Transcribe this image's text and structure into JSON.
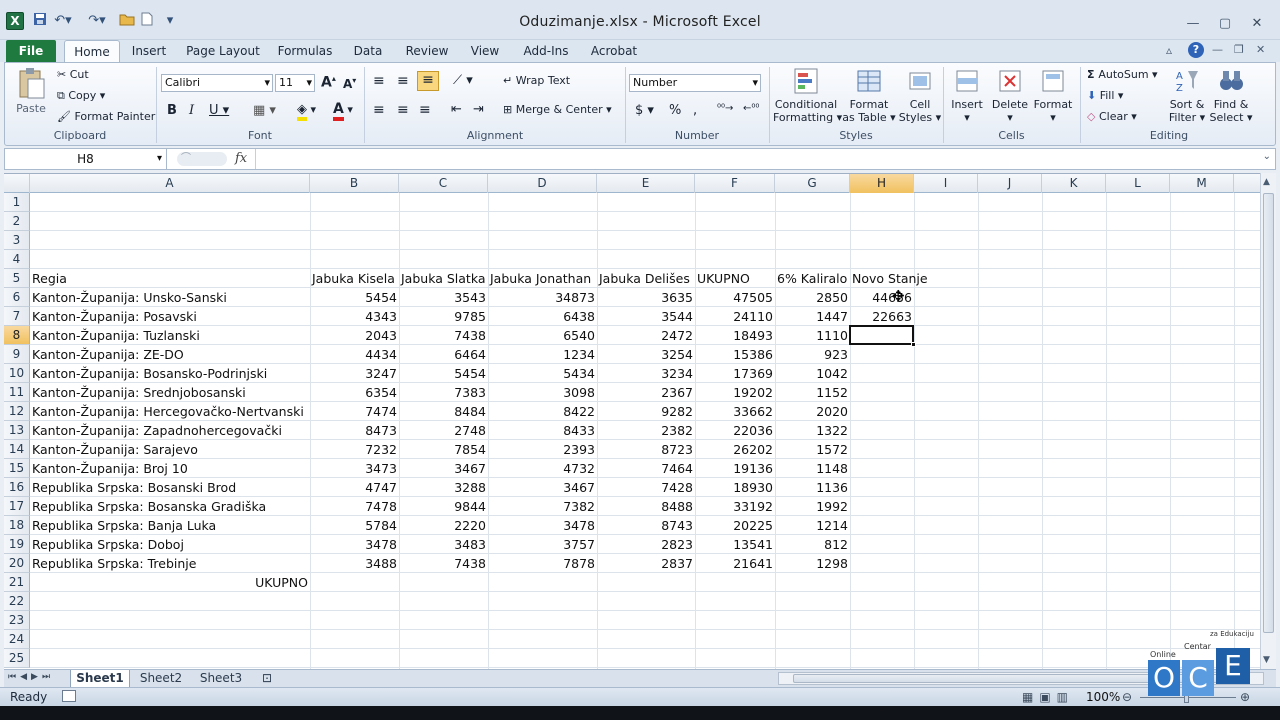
{
  "window": {
    "title": "Oduzimanje.xlsx  -  Microsoft Excel"
  },
  "tabs": [
    "File",
    "Home",
    "Insert",
    "Page Layout",
    "Formulas",
    "Data",
    "Review",
    "View",
    "Add-Ins",
    "Acrobat"
  ],
  "ribbon": {
    "clipboard": {
      "paste": "Paste",
      "cut": "Cut",
      "copy": "Copy",
      "format_painter": "Format Painter",
      "label": "Clipboard"
    },
    "font": {
      "name": "Calibri",
      "size": "11",
      "label": "Font"
    },
    "alignment": {
      "wrap": "Wrap Text",
      "merge": "Merge & Center",
      "label": "Alignment"
    },
    "number": {
      "format": "Number",
      "label": "Number"
    },
    "styles": {
      "cond1": "Conditional",
      "cond2": "Formatting",
      "fmt1": "Format",
      "fmt2": "as Table",
      "cell1": "Cell",
      "cell2": "Styles",
      "label": "Styles"
    },
    "cells": {
      "insert": "Insert",
      "delete": "Delete",
      "format": "Format",
      "label": "Cells"
    },
    "editing": {
      "autosum": "AutoSum",
      "fill": "Fill",
      "clear": "Clear",
      "sort1": "Sort &",
      "sort2": "Filter",
      "find1": "Find &",
      "find2": "Select",
      "label": "Editing"
    }
  },
  "formula_bar": {
    "name_box": "H8",
    "fx": "fx",
    "value": ""
  },
  "columns": [
    "A",
    "B",
    "C",
    "D",
    "E",
    "F",
    "G",
    "H",
    "I",
    "J",
    "K",
    "L",
    "M"
  ],
  "rows": [
    {
      "n": "1",
      "cells": [
        "",
        "",
        "",
        "",
        "",
        "",
        "",
        ""
      ]
    },
    {
      "n": "2",
      "cells": [
        "",
        "",
        "",
        "",
        "",
        "",
        "",
        ""
      ]
    },
    {
      "n": "3",
      "cells": [
        "",
        "",
        "",
        "",
        "",
        "",
        "",
        ""
      ]
    },
    {
      "n": "4",
      "cells": [
        "",
        "",
        "",
        "",
        "",
        "",
        "",
        ""
      ]
    },
    {
      "n": "5",
      "cells": [
        "Regia",
        "Jabuka Kisela",
        "Jabuka Slatka",
        "Jabuka Jonathan",
        "Jabuka Delišes",
        "UKUPNO",
        "6% Kaliralo",
        "Novo Stanje"
      ]
    },
    {
      "n": "6",
      "cells": [
        "Kanton-Županija: Unsko-Sanski",
        "5454",
        "3543",
        "34873",
        "3635",
        "47505",
        "2850",
        "44656"
      ]
    },
    {
      "n": "7",
      "cells": [
        "Kanton-Županija: Posavski",
        "4343",
        "9785",
        "6438",
        "3544",
        "24110",
        "1447",
        "22663"
      ]
    },
    {
      "n": "8",
      "cells": [
        "Kanton-Županija: Tuzlanski",
        "2043",
        "7438",
        "6540",
        "2472",
        "18493",
        "1110",
        ""
      ]
    },
    {
      "n": "9",
      "cells": [
        "Kanton-Županija: ZE-DO",
        "4434",
        "6464",
        "1234",
        "3254",
        "15386",
        "923",
        ""
      ]
    },
    {
      "n": "10",
      "cells": [
        "Kanton-Županija: Bosansko-Podrinjski",
        "3247",
        "5454",
        "5434",
        "3234",
        "17369",
        "1042",
        ""
      ]
    },
    {
      "n": "11",
      "cells": [
        "Kanton-Županija: Srednjobosanski",
        "6354",
        "7383",
        "3098",
        "2367",
        "19202",
        "1152",
        ""
      ]
    },
    {
      "n": "12",
      "cells": [
        "Kanton-Županija: Hercegovačko-Nertvanski",
        "7474",
        "8484",
        "8422",
        "9282",
        "33662",
        "2020",
        ""
      ]
    },
    {
      "n": "13",
      "cells": [
        "Kanton-Županija: Zapadnohercegovački",
        "8473",
        "2748",
        "8433",
        "2382",
        "22036",
        "1322",
        ""
      ]
    },
    {
      "n": "14",
      "cells": [
        "Kanton-Županija: Sarajevo",
        "7232",
        "7854",
        "2393",
        "8723",
        "26202",
        "1572",
        ""
      ]
    },
    {
      "n": "15",
      "cells": [
        "Kanton-Županija: Broj 10",
        "3473",
        "3467",
        "4732",
        "7464",
        "19136",
        "1148",
        ""
      ]
    },
    {
      "n": "16",
      "cells": [
        "Republika Srpska: Bosanski Brod",
        "4747",
        "3288",
        "3467",
        "7428",
        "18930",
        "1136",
        ""
      ]
    },
    {
      "n": "17",
      "cells": [
        "Republika Srpska: Bosanska Gradiška",
        "7478",
        "9844",
        "7382",
        "8488",
        "33192",
        "1992",
        ""
      ]
    },
    {
      "n": "18",
      "cells": [
        "Republika Srpska: Banja Luka",
        "5784",
        "2220",
        "3478",
        "8743",
        "20225",
        "1214",
        ""
      ]
    },
    {
      "n": "19",
      "cells": [
        "Republika Srpska: Doboj",
        "3478",
        "3483",
        "3757",
        "2823",
        "13541",
        "812",
        ""
      ]
    },
    {
      "n": "20",
      "cells": [
        "Republika Srpska: Trebinje",
        "3488",
        "7438",
        "7878",
        "2837",
        "21641",
        "1298",
        ""
      ]
    },
    {
      "n": "21",
      "cells": [
        "UKUPNO",
        "",
        "",
        "",
        "",
        "",
        "",
        ""
      ]
    },
    {
      "n": "22",
      "cells": [
        "",
        "",
        "",
        "",
        "",
        "",
        "",
        ""
      ]
    },
    {
      "n": "23",
      "cells": [
        "",
        "",
        "",
        "",
        "",
        "",
        "",
        ""
      ]
    },
    {
      "n": "24",
      "cells": [
        "",
        "",
        "",
        "",
        "",
        "",
        "",
        ""
      ]
    },
    {
      "n": "25",
      "cells": [
        "",
        "",
        "",
        "",
        "",
        "",
        "",
        ""
      ]
    }
  ],
  "selected_cell": "H8",
  "sheets": [
    "Sheet1",
    "Sheet2",
    "Sheet3"
  ],
  "status": {
    "mode": "Ready",
    "zoom": "100%"
  },
  "watermark": {
    "small": "za Edukaciju",
    "centar": "Centar",
    "online": "Online",
    "letters": "OCE"
  }
}
